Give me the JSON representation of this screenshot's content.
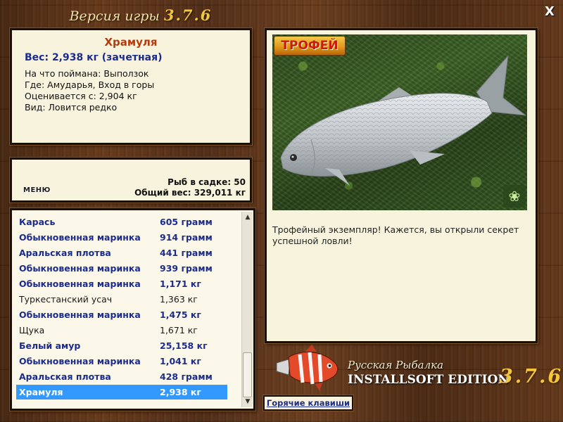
{
  "title": {
    "prefix": "Версия игры",
    "version": "3.7.6",
    "close_label": "X"
  },
  "catch_info": {
    "fish_name": "Храмуля",
    "weight": "Вес: 2,938 кг (зачетная)",
    "bait": "На что поймана: Выползок",
    "location": "Где: Амударья, Вход в горы",
    "valued_from": "Оценивается с: 2,904 кг",
    "kind": "Вид: Ловится редко"
  },
  "stats": {
    "menu_label": "МЕНЮ",
    "count": "Рыб в садке: 50",
    "total_weight": "Общий вес: 329,011 кг"
  },
  "catch_list": [
    {
      "name": "Карась",
      "weight": "605 грамм",
      "style": "bold"
    },
    {
      "name": "Обыкновенная маринка",
      "weight": "914 грамм",
      "style": "bold"
    },
    {
      "name": "Аральская плотва",
      "weight": "441 грамм",
      "style": "bold"
    },
    {
      "name": "Обыкновенная маринка",
      "weight": "939 грамм",
      "style": "bold"
    },
    {
      "name": "Обыкновенная маринка",
      "weight": "1,171 кг",
      "style": "bold"
    },
    {
      "name": "Туркестанский усач",
      "weight": "1,363 кг",
      "style": "plain"
    },
    {
      "name": "Обыкновенная маринка",
      "weight": "1,475 кг",
      "style": "bold"
    },
    {
      "name": "Щука",
      "weight": "1,671 кг",
      "style": "plain"
    },
    {
      "name": "Белый амур",
      "weight": "25,158 кг",
      "style": "bold"
    },
    {
      "name": "Обыкновенная маринка",
      "weight": "1,041 кг",
      "style": "bold"
    },
    {
      "name": "Аральская плотва",
      "weight": "428 грамм",
      "style": "bold"
    },
    {
      "name": "Храмуля",
      "weight": "2,938 кг",
      "style": "selected"
    }
  ],
  "photo": {
    "badge": "ТРОФЕЙ",
    "icon": "butterfly-icon",
    "caption": "Трофейный экземпляр! Кажется, вы открыли секрет успешной ловли!"
  },
  "logo": {
    "title": "Русская Рыбалка",
    "edition": "INSTALLSOFT EDITION",
    "version": "3.7.6"
  },
  "hotkeys_label": "Горячие клавиши",
  "colors": {
    "highlight": "#3399ff",
    "fish_name": "#b83a0a",
    "list_bold": "#1c2c8c",
    "panel_bg": "#f8f3dc",
    "version_gold": "#f3c63b"
  }
}
